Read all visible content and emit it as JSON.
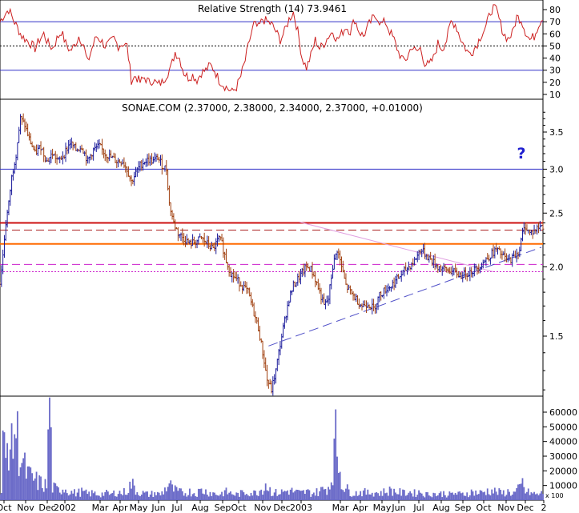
{
  "rsi_panel": {
    "title": "Relative Strength (14) 73.9461",
    "y_ticks": [
      80,
      70,
      60,
      50,
      40,
      30,
      20,
      10
    ],
    "ylim": [
      5,
      87
    ],
    "lines": [
      {
        "value": 70,
        "style": "solid",
        "color": "#3030c8"
      },
      {
        "value": 50,
        "style": "dotted",
        "color": "#000000"
      },
      {
        "value": 30,
        "style": "solid",
        "color": "#3030c8"
      }
    ],
    "line_color": "#cc2020"
  },
  "price_panel": {
    "title": "SONAE.COM (2.37000, 2.38000, 2.34000, 2.37000, +0.01000)",
    "y_ticks": [
      "3.5",
      "3.0",
      "2.5",
      "2.0",
      "1.5"
    ],
    "annotation": "?",
    "annotation_color": "#2020d0",
    "bar_color": "#1a1a9a",
    "down_color": "#a04010",
    "hlines": [
      {
        "value": 3.0,
        "color": "#3030c8",
        "style": "solid"
      },
      {
        "value": 2.4,
        "color": "#cc1010",
        "style": "solid"
      },
      {
        "value": 2.33,
        "color": "#aa2020",
        "style": "dashed"
      },
      {
        "value": 2.2,
        "color": "#ff6a00",
        "style": "solid"
      },
      {
        "value": 2.02,
        "color": "#cc20cc",
        "style": "dashed"
      },
      {
        "value": 1.96,
        "color": "#cc20cc",
        "style": "dotted"
      }
    ]
  },
  "volume_panel": {
    "y_ticks": [
      "60000",
      "50000",
      "40000",
      "30000",
      "20000",
      "10000"
    ],
    "scale_label": "x 100",
    "ylim": [
      0,
      72000
    ],
    "bar_color": "#6a6ac8"
  },
  "x_axis": {
    "labels": [
      "Oct",
      "Nov",
      "Dec",
      "2002",
      "Mar",
      "Apr",
      "May",
      "Jun",
      "Jul",
      "Aug",
      "Sep",
      "Oct",
      "Nov",
      "Dec",
      "2003",
      "Mar",
      "Apr",
      "May",
      "Jun",
      "Jul",
      "Aug",
      "Sep",
      "Oct",
      "Nov",
      "Dec",
      "2"
    ]
  },
  "chart_data": {
    "type": "ohlc",
    "title": "SONAE.COM (2.37000, 2.38000, 2.34000, 2.37000, +0.01000)",
    "x_range": [
      "2001-10",
      "2003-12"
    ],
    "price_ylim": [
      1.1,
      3.9
    ],
    "price_scale": "log",
    "price_path": [
      [
        0,
        1.87
      ],
      [
        2,
        2.1
      ],
      [
        4,
        2.4
      ],
      [
        6,
        2.6
      ],
      [
        8,
        2.9
      ],
      [
        11,
        3.2
      ],
      [
        14,
        3.7
      ],
      [
        17,
        3.6
      ],
      [
        20,
        3.4
      ],
      [
        24,
        3.2
      ],
      [
        28,
        3.3
      ],
      [
        32,
        3.1
      ],
      [
        36,
        3.2
      ],
      [
        40,
        3.1
      ],
      [
        44,
        3.2
      ],
      [
        48,
        3.35
      ],
      [
        52,
        3.25
      ],
      [
        56,
        3.3
      ],
      [
        60,
        3.1
      ],
      [
        64,
        3.25
      ],
      [
        68,
        3.3
      ],
      [
        72,
        3.2
      ],
      [
        76,
        3.15
      ],
      [
        80,
        3.1
      ],
      [
        84,
        3.1
      ],
      [
        87,
        3.0
      ],
      [
        90,
        2.85
      ],
      [
        93,
        2.95
      ],
      [
        96,
        3.05
      ],
      [
        99,
        3.1
      ],
      [
        102,
        3.12
      ],
      [
        105,
        3.1
      ],
      [
        108,
        3.15
      ],
      [
        111,
        3.05
      ],
      [
        114,
        3.0
      ],
      [
        116,
        2.6
      ],
      [
        119,
        2.4
      ],
      [
        122,
        2.3
      ],
      [
        126,
        2.25
      ],
      [
        130,
        2.2
      ],
      [
        134,
        2.22
      ],
      [
        138,
        2.25
      ],
      [
        142,
        2.2
      ],
      [
        146,
        2.15
      ],
      [
        150,
        2.25
      ],
      [
        152,
        2.2
      ],
      [
        155,
        2.05
      ],
      [
        158,
        1.95
      ],
      [
        162,
        1.9
      ],
      [
        166,
        1.85
      ],
      [
        170,
        1.8
      ],
      [
        174,
        1.65
      ],
      [
        177,
        1.55
      ],
      [
        180,
        1.4
      ],
      [
        183,
        1.25
      ],
      [
        186,
        1.2
      ],
      [
        189,
        1.3
      ],
      [
        192,
        1.45
      ],
      [
        195,
        1.6
      ],
      [
        198,
        1.75
      ],
      [
        201,
        1.85
      ],
      [
        204,
        1.9
      ],
      [
        207,
        1.95
      ],
      [
        210,
        2.0
      ],
      [
        213,
        1.98
      ],
      [
        216,
        1.9
      ],
      [
        219,
        1.8
      ],
      [
        222,
        1.7
      ],
      [
        225,
        1.75
      ],
      [
        228,
        2.0
      ],
      [
        231,
        2.15
      ],
      [
        234,
        2.0
      ],
      [
        237,
        1.85
      ],
      [
        240,
        1.8
      ],
      [
        244,
        1.75
      ],
      [
        248,
        1.7
      ],
      [
        252,
        1.72
      ],
      [
        256,
        1.68
      ],
      [
        260,
        1.78
      ],
      [
        264,
        1.82
      ],
      [
        268,
        1.85
      ],
      [
        272,
        1.9
      ],
      [
        276,
        1.95
      ],
      [
        280,
        2.0
      ],
      [
        284,
        2.05
      ],
      [
        288,
        2.15
      ],
      [
        292,
        2.1
      ],
      [
        296,
        2.05
      ],
      [
        300,
        2.0
      ],
      [
        304,
        1.98
      ],
      [
        308,
        1.97
      ],
      [
        312,
        1.95
      ],
      [
        316,
        1.93
      ],
      [
        320,
        1.95
      ],
      [
        324,
        1.97
      ],
      [
        328,
        2.0
      ],
      [
        332,
        2.05
      ],
      [
        336,
        2.1
      ],
      [
        340,
        2.15
      ],
      [
        344,
        2.1
      ],
      [
        348,
        2.05
      ],
      [
        352,
        2.08
      ],
      [
        356,
        2.15
      ],
      [
        358,
        2.3
      ],
      [
        360,
        2.37
      ],
      [
        363,
        2.3
      ],
      [
        366,
        2.32
      ],
      [
        370,
        2.37
      ]
    ],
    "trendlines": [
      {
        "from": [
          184,
          1.44
        ],
        "to": [
          371,
          2.17
        ],
        "color": "#5050c8",
        "style": "dashed"
      },
      {
        "from": [
          205,
          2.41
        ],
        "to": [
          338,
          1.96
        ],
        "color": "#e0a0e0",
        "style": "solid"
      }
    ],
    "rsi_path": [
      [
        0,
        70
      ],
      [
        3,
        76
      ],
      [
        6,
        80
      ],
      [
        9,
        72
      ],
      [
        12,
        65
      ],
      [
        15,
        58
      ],
      [
        18,
        55
      ],
      [
        21,
        52
      ],
      [
        24,
        48
      ],
      [
        27,
        55
      ],
      [
        30,
        60
      ],
      [
        33,
        52
      ],
      [
        36,
        48
      ],
      [
        39,
        56
      ],
      [
        42,
        62
      ],
      [
        45,
        52
      ],
      [
        48,
        46
      ],
      [
        51,
        50
      ],
      [
        54,
        58
      ],
      [
        57,
        52
      ],
      [
        60,
        36
      ],
      [
        63,
        48
      ],
      [
        66,
        58
      ],
      [
        69,
        55
      ],
      [
        72,
        50
      ],
      [
        75,
        52
      ],
      [
        78,
        56
      ],
      [
        81,
        50
      ],
      [
        84,
        52
      ],
      [
        87,
        50
      ],
      [
        90,
        22
      ],
      [
        93,
        25
      ],
      [
        96,
        20
      ],
      [
        99,
        24
      ],
      [
        102,
        20
      ],
      [
        105,
        22
      ],
      [
        108,
        18
      ],
      [
        111,
        20
      ],
      [
        114,
        26
      ],
      [
        117,
        32
      ],
      [
        120,
        45
      ],
      [
        123,
        40
      ],
      [
        126,
        28
      ],
      [
        129,
        24
      ],
      [
        132,
        26
      ],
      [
        135,
        22
      ],
      [
        138,
        28
      ],
      [
        141,
        30
      ],
      [
        144,
        34
      ],
      [
        147,
        30
      ],
      [
        150,
        22
      ],
      [
        153,
        18
      ],
      [
        156,
        15
      ],
      [
        159,
        12
      ],
      [
        162,
        16
      ],
      [
        165,
        25
      ],
      [
        168,
        38
      ],
      [
        171,
        55
      ],
      [
        174,
        68
      ],
      [
        177,
        65
      ],
      [
        180,
        72
      ],
      [
        183,
        70
      ],
      [
        186,
        68
      ],
      [
        189,
        62
      ],
      [
        192,
        55
      ],
      [
        195,
        62
      ],
      [
        198,
        72
      ],
      [
        201,
        78
      ],
      [
        204,
        62
      ],
      [
        207,
        40
      ],
      [
        210,
        32
      ],
      [
        213,
        42
      ],
      [
        216,
        55
      ],
      [
        219,
        48
      ],
      [
        222,
        52
      ],
      [
        225,
        58
      ],
      [
        228,
        62
      ],
      [
        231,
        55
      ],
      [
        234,
        60
      ],
      [
        237,
        66
      ],
      [
        240,
        62
      ],
      [
        243,
        72
      ],
      [
        246,
        62
      ],
      [
        249,
        58
      ],
      [
        252,
        66
      ],
      [
        255,
        72
      ],
      [
        258,
        75
      ],
      [
        261,
        68
      ],
      [
        264,
        70
      ],
      [
        267,
        62
      ],
      [
        270,
        55
      ],
      [
        273,
        45
      ],
      [
        276,
        38
      ],
      [
        279,
        40
      ],
      [
        282,
        50
      ],
      [
        285,
        45
      ],
      [
        288,
        48
      ],
      [
        291,
        36
      ],
      [
        294,
        34
      ],
      [
        297,
        40
      ],
      [
        300,
        52
      ],
      [
        303,
        48
      ],
      [
        306,
        55
      ],
      [
        309,
        70
      ],
      [
        312,
        68
      ],
      [
        315,
        58
      ],
      [
        318,
        50
      ],
      [
        321,
        44
      ],
      [
        324,
        46
      ],
      [
        327,
        52
      ],
      [
        330,
        60
      ],
      [
        333,
        66
      ],
      [
        336,
        78
      ],
      [
        339,
        84
      ],
      [
        342,
        72
      ],
      [
        345,
        60
      ],
      [
        348,
        56
      ],
      [
        351,
        60
      ],
      [
        354,
        74
      ],
      [
        357,
        72
      ],
      [
        360,
        62
      ],
      [
        363,
        55
      ],
      [
        366,
        58
      ],
      [
        369,
        68
      ],
      [
        372,
        74
      ]
    ],
    "volume_path": [
      [
        2,
        40000
      ],
      [
        4,
        28000
      ],
      [
        6,
        48000
      ],
      [
        8,
        35000
      ],
      [
        10,
        53000
      ],
      [
        12,
        44000
      ],
      [
        14,
        32000
      ],
      [
        16,
        25000
      ],
      [
        18,
        20000
      ],
      [
        20,
        17000
      ],
      [
        24,
        14000
      ],
      [
        28,
        12000
      ],
      [
        32,
        10000
      ],
      [
        34,
        70000
      ],
      [
        36,
        9000
      ],
      [
        40,
        7000
      ],
      [
        44,
        9000
      ],
      [
        48,
        6000
      ],
      [
        52,
        5000
      ],
      [
        56,
        6000
      ],
      [
        60,
        4500
      ],
      [
        64,
        5000
      ],
      [
        68,
        4000
      ],
      [
        72,
        5000
      ],
      [
        76,
        4000
      ],
      [
        80,
        6000
      ],
      [
        84,
        5000
      ],
      [
        88,
        8000
      ],
      [
        90,
        12000
      ],
      [
        94,
        6000
      ],
      [
        98,
        5000
      ],
      [
        102,
        4000
      ],
      [
        106,
        5000
      ],
      [
        110,
        4000
      ],
      [
        114,
        9000
      ],
      [
        116,
        12000
      ],
      [
        118,
        8000
      ],
      [
        122,
        6000
      ],
      [
        126,
        5000
      ],
      [
        130,
        6000
      ],
      [
        134,
        5000
      ],
      [
        138,
        7000
      ],
      [
        142,
        6000
      ],
      [
        146,
        5000
      ],
      [
        150,
        4000
      ],
      [
        154,
        6000
      ],
      [
        158,
        5000
      ],
      [
        162,
        4000
      ],
      [
        166,
        5000
      ],
      [
        170,
        6000
      ],
      [
        174,
        5000
      ],
      [
        178,
        7000
      ],
      [
        180,
        9000
      ],
      [
        182,
        12000
      ],
      [
        186,
        6000
      ],
      [
        190,
        5000
      ],
      [
        194,
        6000
      ],
      [
        198,
        7000
      ],
      [
        202,
        6000
      ],
      [
        206,
        5000
      ],
      [
        210,
        6000
      ],
      [
        214,
        5000
      ],
      [
        218,
        6000
      ],
      [
        222,
        8000
      ],
      [
        226,
        10000
      ],
      [
        228,
        25000
      ],
      [
        230,
        43000
      ],
      [
        232,
        28000
      ],
      [
        234,
        15000
      ],
      [
        236,
        9000
      ],
      [
        240,
        6000
      ],
      [
        244,
        5000
      ],
      [
        248,
        6000
      ],
      [
        252,
        5000
      ],
      [
        256,
        6000
      ],
      [
        260,
        5000
      ],
      [
        264,
        6000
      ],
      [
        268,
        7000
      ],
      [
        272,
        6000
      ],
      [
        276,
        5000
      ],
      [
        280,
        6000
      ],
      [
        284,
        5000
      ],
      [
        288,
        6000
      ],
      [
        292,
        4000
      ],
      [
        296,
        5000
      ],
      [
        300,
        4000
      ],
      [
        304,
        5000
      ],
      [
        308,
        4000
      ],
      [
        312,
        5000
      ],
      [
        316,
        4000
      ],
      [
        320,
        5000
      ],
      [
        324,
        6000
      ],
      [
        328,
        5000
      ],
      [
        332,
        6000
      ],
      [
        336,
        7000
      ],
      [
        340,
        6000
      ],
      [
        344,
        5000
      ],
      [
        348,
        6000
      ],
      [
        352,
        5000
      ],
      [
        356,
        8000
      ],
      [
        358,
        12000
      ],
      [
        360,
        6000
      ],
      [
        364,
        5000
      ],
      [
        368,
        4000
      ],
      [
        372,
        5000
      ]
    ]
  }
}
